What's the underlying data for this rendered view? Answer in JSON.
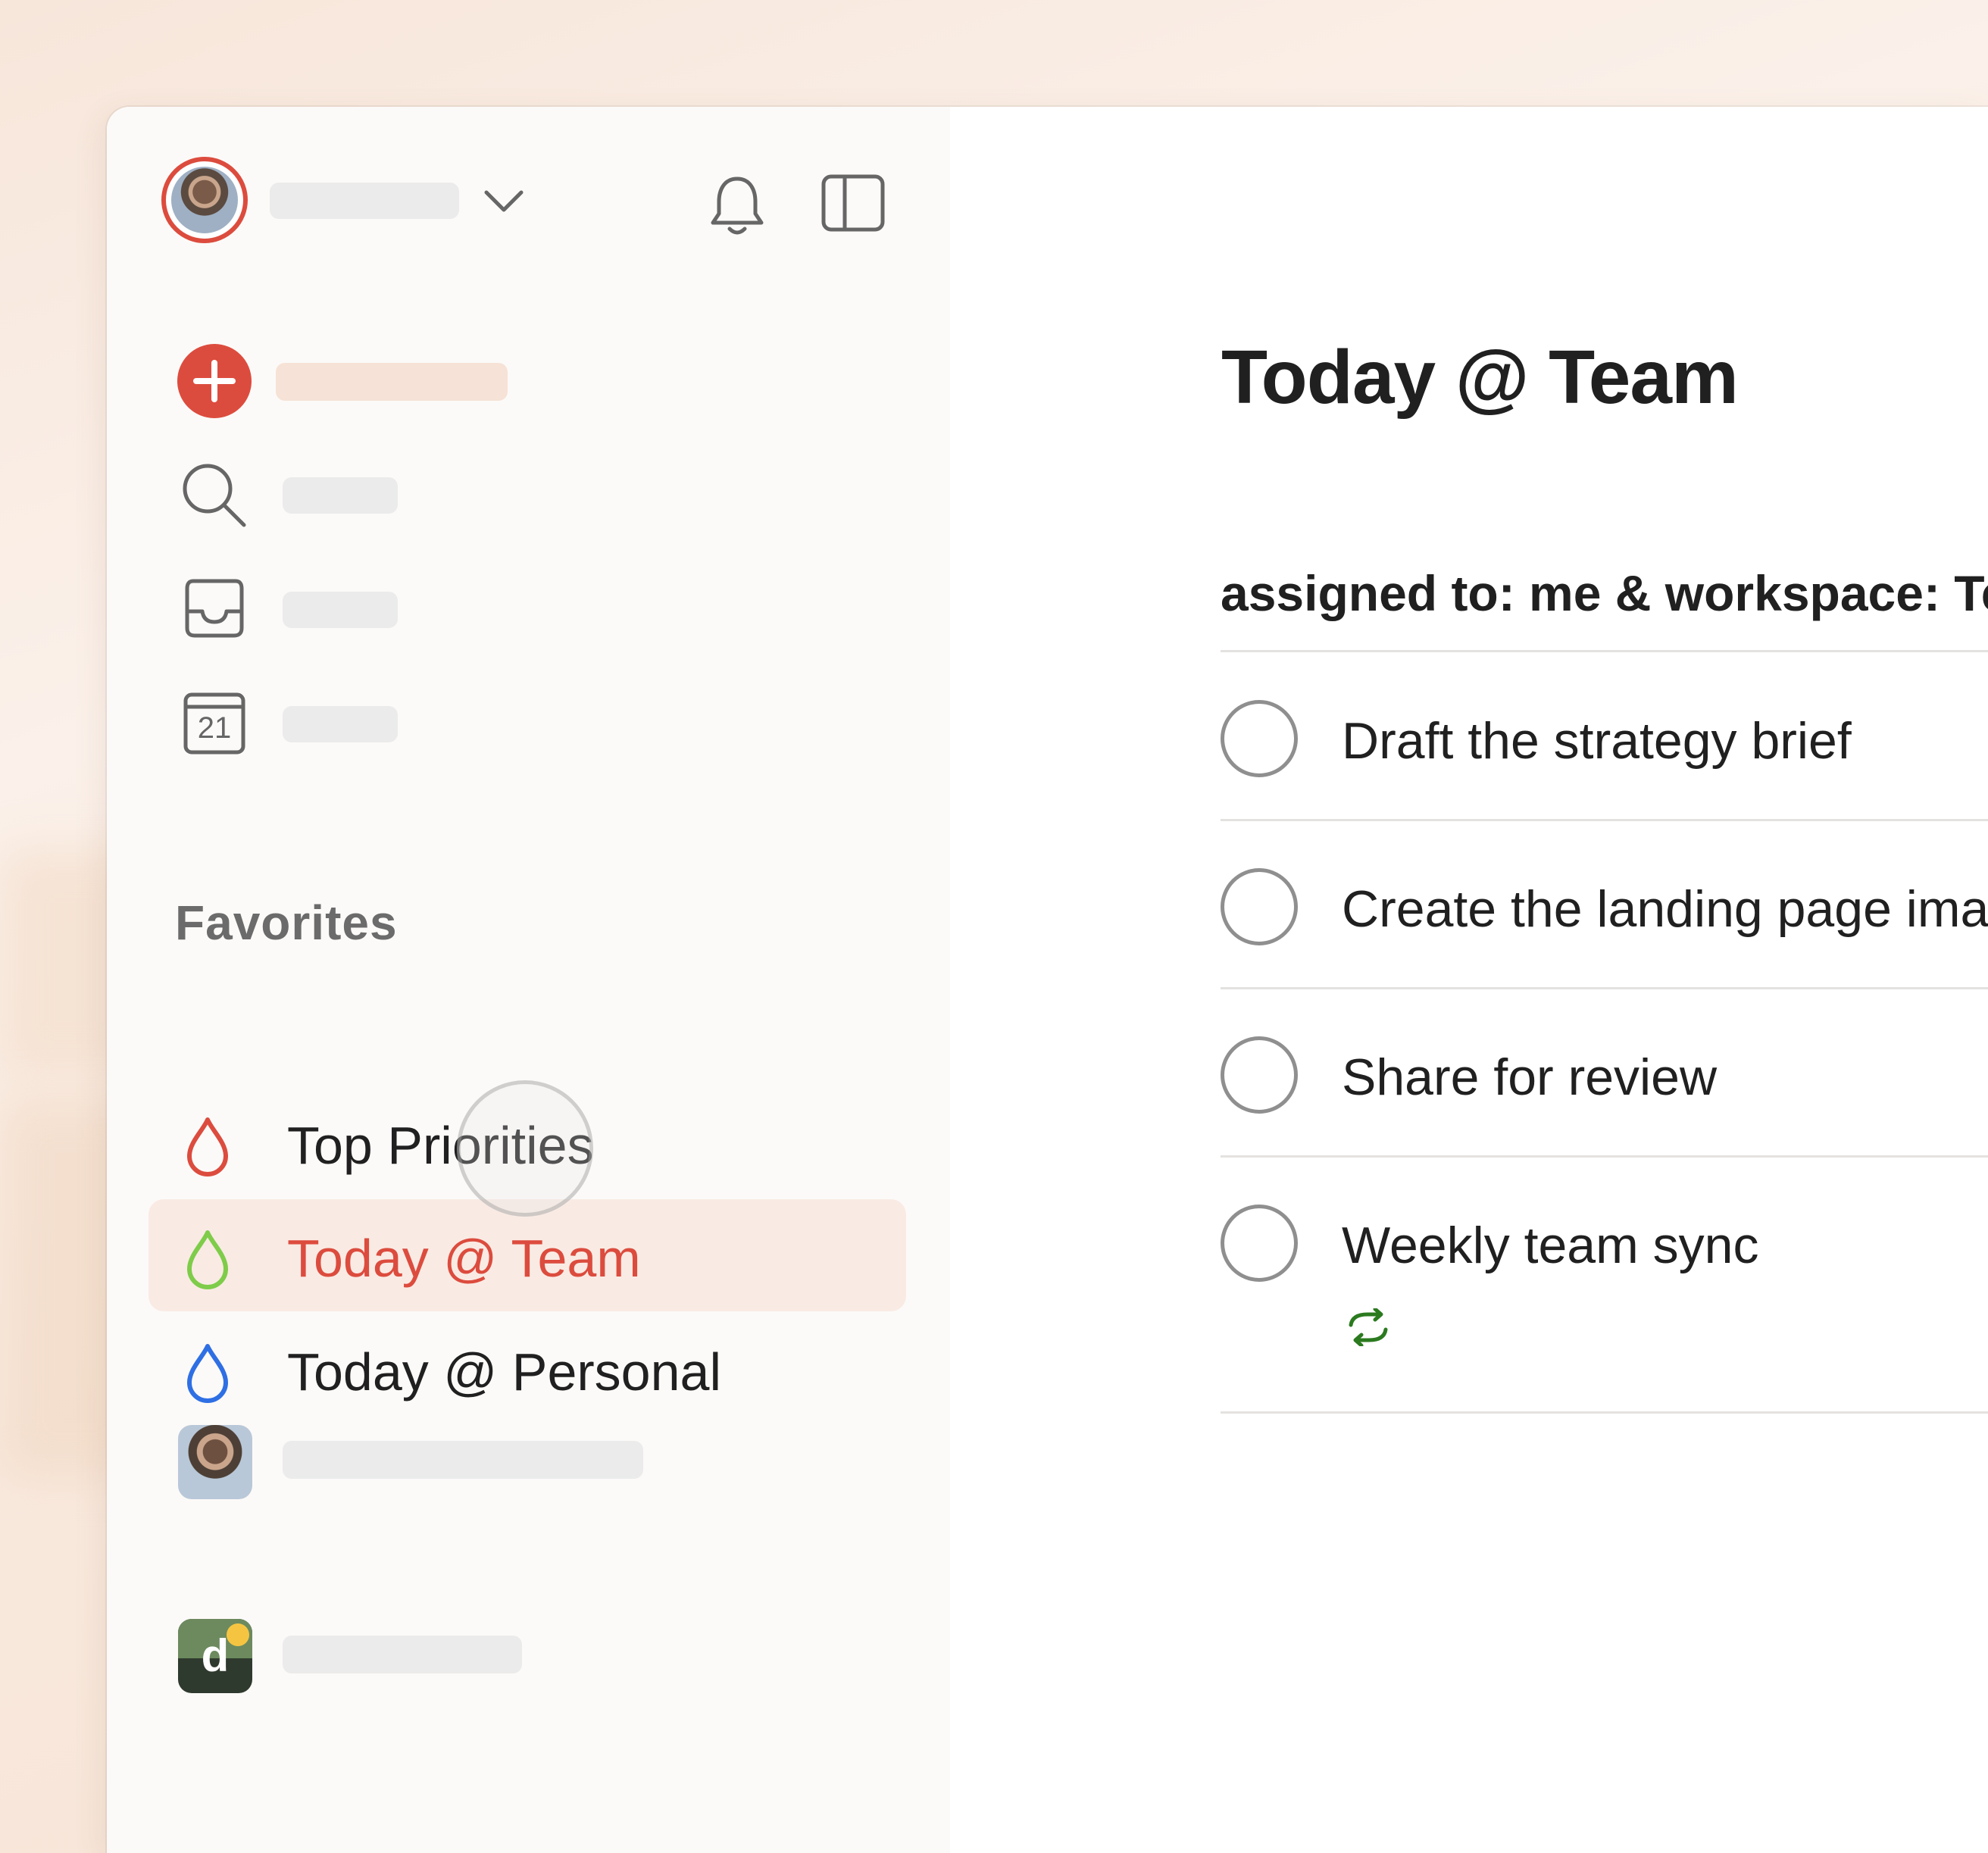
{
  "main": {
    "title": "Today @ Team",
    "filter_label": "assigned to: me & workspace: Tea",
    "tasks": [
      {
        "text": "Draft the strategy brief"
      },
      {
        "text": "Create the landing page image"
      },
      {
        "text": "Share for review"
      },
      {
        "text": "Weekly team sync",
        "recurring_icon": "recurring-icon"
      }
    ]
  },
  "sidebar": {
    "calendar_day": "21",
    "favorites_title": "Favorites",
    "favorites": [
      {
        "label": "Top Priorities",
        "color": "#dc4c3e"
      },
      {
        "label": "Today @ Team",
        "color": "#7ecc49"
      },
      {
        "label": "Today @ Personal",
        "color": "#2f6fe4"
      }
    ],
    "workspace_letter": "d"
  },
  "colors": {
    "accent": "#dc4c3e",
    "recurring_green": "#2b7a1f",
    "active_bg": "#f9ebe4"
  }
}
